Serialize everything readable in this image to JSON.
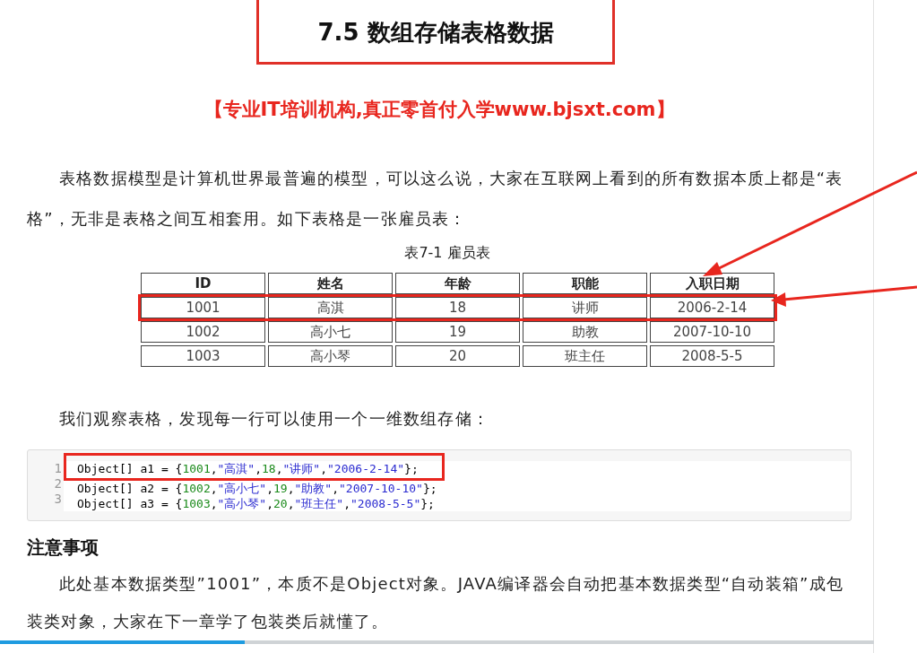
{
  "title": "7.5 数组存储表格数据",
  "banner": "【专业IT培训机构,真正零首付入学www.bjsxt.com】",
  "intro": "表格数据模型是计算机世界最普遍的模型，可以这么说，大家在互联网上看到的所有数据本质上都是“表格”，无非是表格之间互相套用。如下表格是一张雇员表：",
  "table": {
    "caption": "表7-1 雇员表",
    "columns": [
      "ID",
      "姓名",
      "年龄",
      "职能",
      "入职日期"
    ],
    "rows": [
      {
        "cells": [
          "1001",
          "高淇",
          "18",
          "讲师",
          "2006-2-14"
        ],
        "highlighted": true
      },
      {
        "cells": [
          "1002",
          "高小七",
          "19",
          "助教",
          "2007-10-10"
        ],
        "highlighted": false
      },
      {
        "cells": [
          "1003",
          "高小琴",
          "20",
          "班主任",
          "2008-5-5"
        ],
        "highlighted": false
      }
    ]
  },
  "observation": "我们观察表格，发现每一行可以使用一个一维数组存储：",
  "code": {
    "lines": [
      {
        "number": "1",
        "highlighted": true,
        "tokens": [
          {
            "kind": "plain",
            "text": "Object[] a1 = {"
          },
          {
            "kind": "number",
            "text": "1001"
          },
          {
            "kind": "plain",
            "text": ","
          },
          {
            "kind": "string",
            "text": "\"高淇\""
          },
          {
            "kind": "plain",
            "text": ","
          },
          {
            "kind": "number",
            "text": "18"
          },
          {
            "kind": "plain",
            "text": ","
          },
          {
            "kind": "string",
            "text": "\"讲师\""
          },
          {
            "kind": "plain",
            "text": ","
          },
          {
            "kind": "string",
            "text": "\"2006-2-14\""
          },
          {
            "kind": "plain",
            "text": "};"
          }
        ]
      },
      {
        "number": "2",
        "highlighted": false,
        "tokens": [
          {
            "kind": "plain",
            "text": "Object[] a2 = {"
          },
          {
            "kind": "number",
            "text": "1002"
          },
          {
            "kind": "plain",
            "text": ","
          },
          {
            "kind": "string",
            "text": "\"高小七\""
          },
          {
            "kind": "plain",
            "text": ","
          },
          {
            "kind": "number",
            "text": "19"
          },
          {
            "kind": "plain",
            "text": ","
          },
          {
            "kind": "string",
            "text": "\"助教\""
          },
          {
            "kind": "plain",
            "text": ","
          },
          {
            "kind": "string",
            "text": "\"2007-10-10\""
          },
          {
            "kind": "plain",
            "text": "};"
          }
        ]
      },
      {
        "number": "3",
        "highlighted": false,
        "tokens": [
          {
            "kind": "plain",
            "text": "Object[] a3 = {"
          },
          {
            "kind": "number",
            "text": "1003"
          },
          {
            "kind": "plain",
            "text": ","
          },
          {
            "kind": "string",
            "text": "\"高小琴\""
          },
          {
            "kind": "plain",
            "text": ","
          },
          {
            "kind": "number",
            "text": "20"
          },
          {
            "kind": "plain",
            "text": ","
          },
          {
            "kind": "string",
            "text": "\"班主任\""
          },
          {
            "kind": "plain",
            "text": ","
          },
          {
            "kind": "string",
            "text": "\"2008-5-5\""
          },
          {
            "kind": "plain",
            "text": "};"
          }
        ]
      }
    ]
  },
  "notes_heading": "注意事项",
  "notes": "此处基本数据类型”1001”，本质不是Object对象。JAVA编译器会自动把基本数据类型“自动装箱”成包装类对象，大家在下一章学了包装类后就懂了。",
  "player": {
    "level": 0.28
  }
}
